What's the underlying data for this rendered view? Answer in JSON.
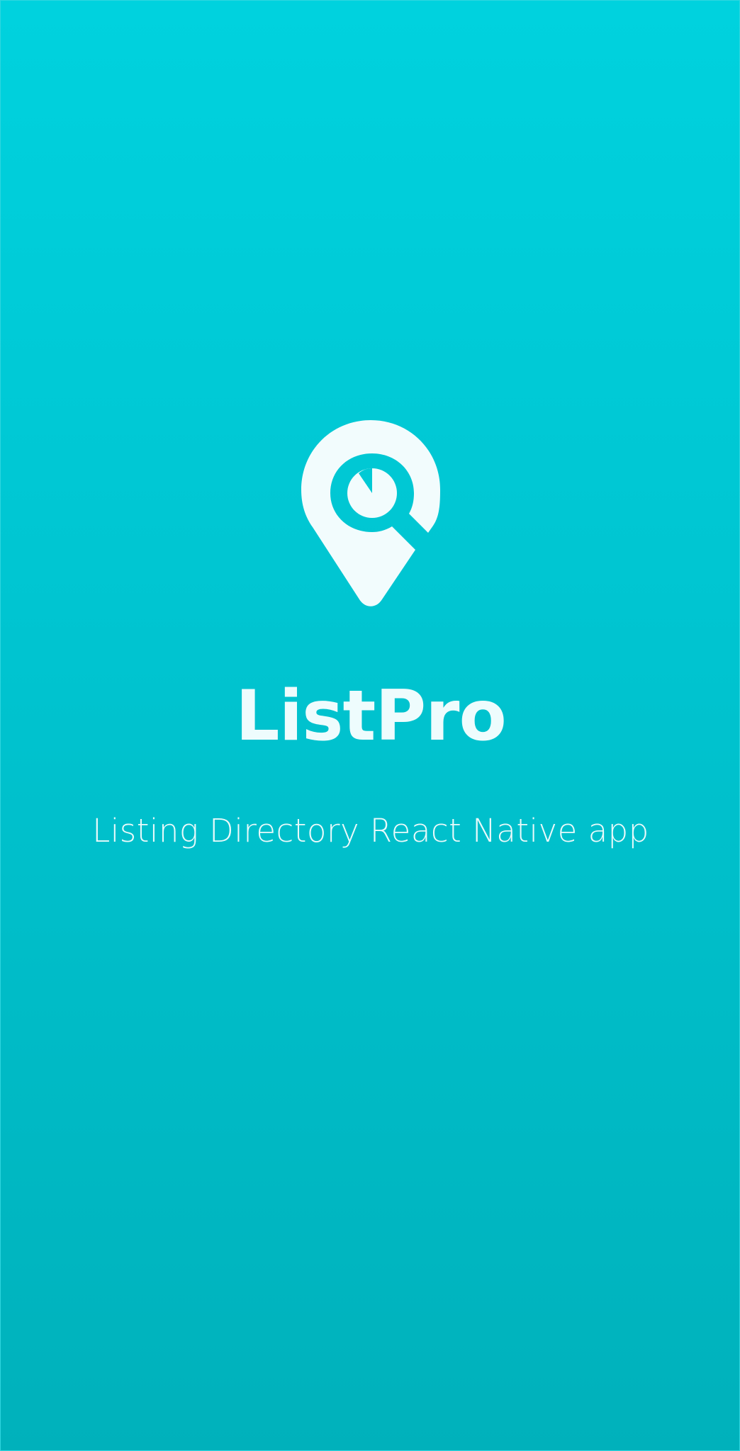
{
  "splash": {
    "title": "ListPro",
    "subtitle": "Listing Directory React Native app",
    "logo_icon": "map-pin-search-icon"
  },
  "colors": {
    "background_top": "#00d2de",
    "background_bottom": "#00b1bb",
    "foreground": "#eefcfd"
  }
}
